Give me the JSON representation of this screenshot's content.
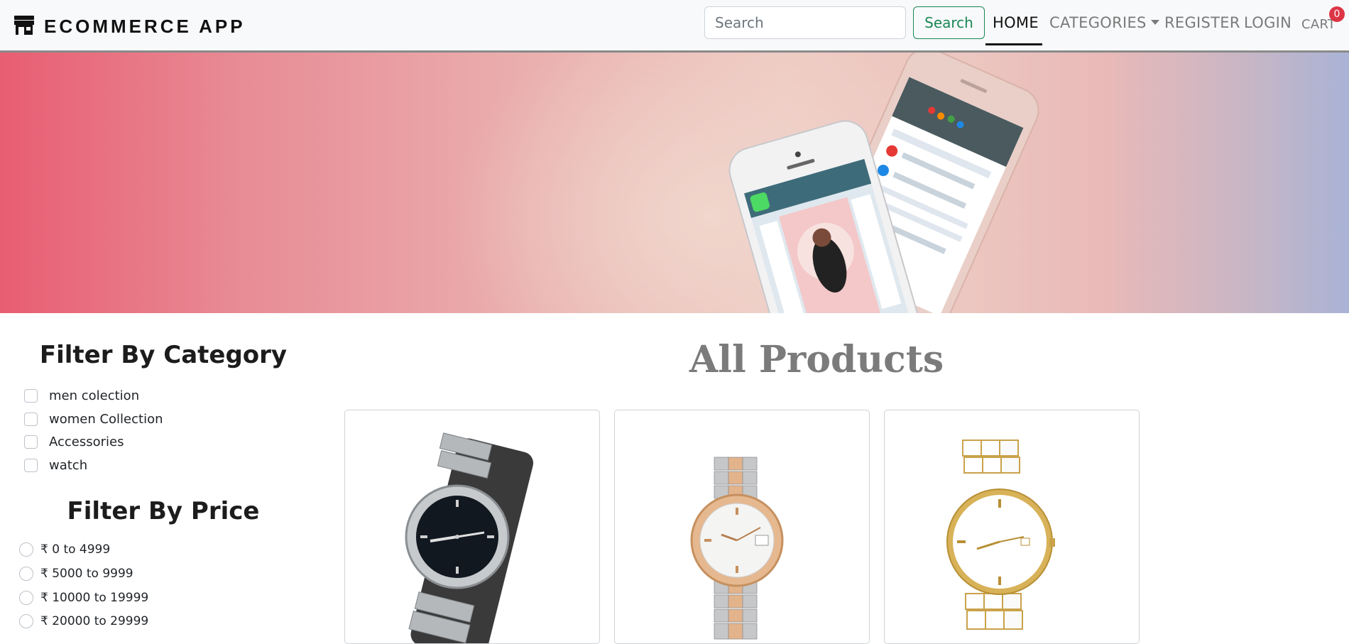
{
  "navbar": {
    "brand": "ECOMMERCE APP",
    "brand_icon": "shop-icon",
    "search": {
      "placeholder": "Search",
      "value": ""
    },
    "search_button": "Search",
    "links": {
      "home": "HOME",
      "categories": "CATEGORIES",
      "register": "REGISTER",
      "login": "LOGIN",
      "cart": "CART"
    },
    "cart_count": "0",
    "active": "HOME"
  },
  "hero": {
    "image": "two-smartphones-banner"
  },
  "sidebar": {
    "category_title": "Filter By Category",
    "categories": [
      {
        "label": "men colection",
        "checked": false
      },
      {
        "label": "women Collection",
        "checked": false
      },
      {
        "label": "Accessories",
        "checked": false
      },
      {
        "label": "watch",
        "checked": false
      }
    ],
    "price_title": "Filter By Price",
    "prices": [
      {
        "label": "₹ 0 to 4999",
        "checked": false
      },
      {
        "label": "₹ 5000 to 9999",
        "checked": false
      },
      {
        "label": "₹ 10000 to 19999",
        "checked": false
      },
      {
        "label": "₹ 20000 to 29999",
        "checked": false
      }
    ]
  },
  "main": {
    "title": "All Products",
    "products": [
      {
        "image": "black-dial-steel-watch"
      },
      {
        "image": "two-tone-gold-steel-watch"
      },
      {
        "image": "white-ceramic-gold-watch"
      }
    ]
  },
  "colors": {
    "accent_green": "#198754",
    "badge_red": "#dc3545",
    "heading_grey": "#7b7b7b"
  }
}
